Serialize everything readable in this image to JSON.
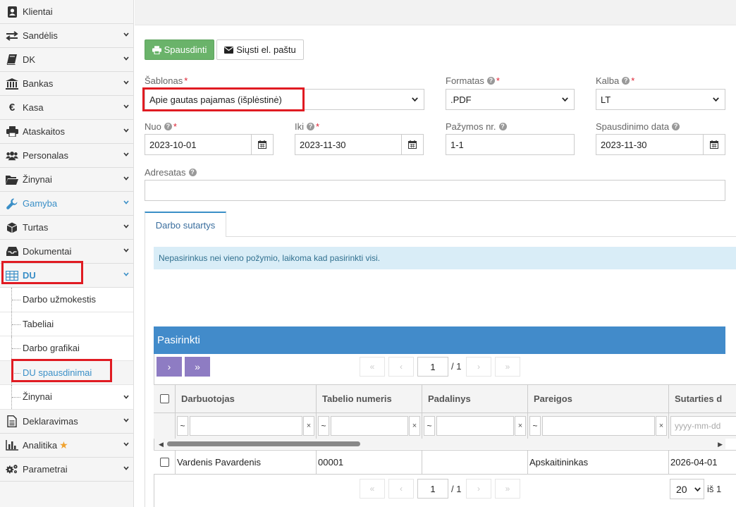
{
  "sidebar": {
    "items": [
      {
        "label": "Klientai",
        "icon": "contacts-icon"
      },
      {
        "label": "Sandėlis",
        "icon": "transfer-icon"
      },
      {
        "label": "DK",
        "icon": "book-icon"
      },
      {
        "label": "Bankas",
        "icon": "bank-icon"
      },
      {
        "label": "Kasa",
        "icon": "euro-icon"
      },
      {
        "label": "Ataskaitos",
        "icon": "print-icon"
      },
      {
        "label": "Personalas",
        "icon": "users-icon"
      },
      {
        "label": "Žinynai",
        "icon": "folder-open-icon"
      },
      {
        "label": "Gamyba",
        "icon": "wrench-icon"
      },
      {
        "label": "Turtas",
        "icon": "cube-icon"
      },
      {
        "label": "Dokumentai",
        "icon": "inbox-icon"
      },
      {
        "label": "DU",
        "icon": "table-icon"
      }
    ],
    "du_sub": [
      {
        "label": "Darbo užmokestis"
      },
      {
        "label": "Tabeliai"
      },
      {
        "label": "Darbo grafikai"
      },
      {
        "label": "DU spausdinimai"
      },
      {
        "label": "Žinynai"
      }
    ],
    "bottom_items": [
      {
        "label": "Deklaravimas",
        "icon": "document-icon"
      },
      {
        "label": "Analitika",
        "icon": "bar-chart-icon"
      },
      {
        "label": "Parametrai",
        "icon": "gears-icon"
      }
    ]
  },
  "toolbar": {
    "print_label": "Spausdinti",
    "email_label": "Siųsti el. paštu"
  },
  "form": {
    "template_label": "Šablonas",
    "template_value": "Apie gautas pajamas (išplėstinė)",
    "format_label": "Formatas",
    "format_value": ".PDF",
    "language_label": "Kalba",
    "language_value": "LT",
    "from_label": "Nuo",
    "from_value": "2023-10-01",
    "to_label": "Iki",
    "to_value": "2023-11-30",
    "cert_label": "Pažymos nr.",
    "cert_value": "1-1",
    "print_date_label": "Spausdinimo data",
    "print_date_value": "2023-11-30",
    "addressee_label": "Adresatas",
    "addressee_value": "",
    "required_mark": "*"
  },
  "tabs": [
    {
      "label": "Darbo sutartys"
    }
  ],
  "info_text": "Nepasirinkus nei vieno požymio, laikoma kad pasirinkti visi.",
  "grid": {
    "title": "Pasirinkti",
    "page": "1",
    "page_total": "/ 1",
    "columns": [
      "Darbuotojas",
      "Tabelio numeris",
      "Padalinys",
      "Pareigos",
      "Sutarties d"
    ],
    "filter_tilde": "~",
    "filter_clear": "×",
    "date_placeholder": "yyyy-mm-dd",
    "rows": [
      {
        "employee": "Vardenis Pavardenis",
        "tab_no": "00001",
        "unit": "",
        "position": "Apskaitininkas",
        "contract_date": "2026-04-01"
      }
    ],
    "page_size": "20",
    "of_label": "iš 1"
  },
  "colors": {
    "accent": "#3a8fc7",
    "print_button": "#6ab36a",
    "grid_header": "#428bca",
    "move_button": "#8e7cc3",
    "highlight": "#e01b22"
  }
}
